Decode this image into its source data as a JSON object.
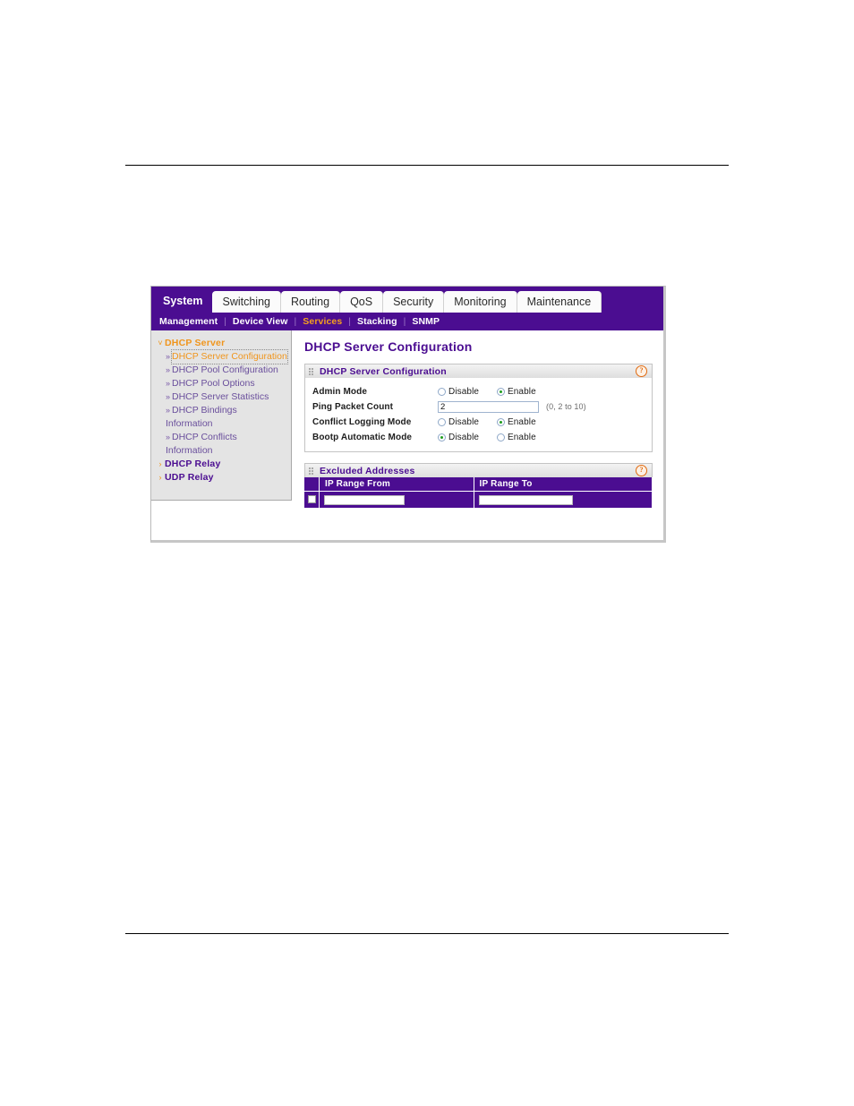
{
  "window": {
    "main_tabs": [
      {
        "label": "System",
        "active": true
      },
      {
        "label": "Switching",
        "active": false
      },
      {
        "label": "Routing",
        "active": false
      },
      {
        "label": "QoS",
        "active": false
      },
      {
        "label": "Security",
        "active": false
      },
      {
        "label": "Monitoring",
        "active": false
      },
      {
        "label": "Maintenance",
        "active": false
      }
    ],
    "sub_nav": [
      {
        "label": "Management",
        "active": false
      },
      {
        "label": "Device View",
        "active": false
      },
      {
        "label": "Services",
        "active": true
      },
      {
        "label": "Stacking",
        "active": false
      },
      {
        "label": "SNMP",
        "active": false
      }
    ],
    "sub_nav_separator": "|"
  },
  "sidebar": {
    "root": {
      "label": "DHCP Server",
      "chevron": "expanded-chevron-icon",
      "chevron_glyph": "˅"
    },
    "items": [
      {
        "label": "DHCP Server Configuration",
        "bullet": "»",
        "selected": true
      },
      {
        "label": "DHCP Pool Configuration",
        "bullet": "»",
        "selected": false
      },
      {
        "label": "DHCP Pool Options",
        "bullet": "»",
        "selected": false
      },
      {
        "label": "DHCP Server Statistics",
        "bullet": "»",
        "selected": false
      },
      {
        "label": "DHCP Bindings",
        "label2": "Information",
        "bullet": "»",
        "selected": false
      },
      {
        "label": "DHCP Conflicts",
        "label2": "Information",
        "bullet": "»",
        "selected": false
      }
    ],
    "groups": [
      {
        "label": "DHCP Relay",
        "chevron_glyph": "›"
      },
      {
        "label": "UDP Relay",
        "chevron_glyph": "›"
      }
    ]
  },
  "main": {
    "page_title": "DHCP Server Configuration",
    "panel_config": {
      "title": "DHCP Server Configuration",
      "help_glyph": "?",
      "rows": {
        "admin_mode": {
          "label": "Admin Mode",
          "disable_label": "Disable",
          "enable_label": "Enable",
          "selected": "Enable"
        },
        "ping_packet_count": {
          "label": "Ping Packet Count",
          "value": "2",
          "hint": "(0, 2 to 10)"
        },
        "conflict_logging_mode": {
          "label": "Conflict Logging Mode",
          "disable_label": "Disable",
          "enable_label": "Enable",
          "selected": "Enable"
        },
        "bootp_automatic_mode": {
          "label": "Bootp Automatic Mode",
          "disable_label": "Disable",
          "enable_label": "Enable",
          "selected": "Disable"
        }
      }
    },
    "panel_excluded": {
      "title": "Excluded Addresses",
      "help_glyph": "?",
      "columns": [
        "IP Range From",
        "IP Range To"
      ],
      "rows": [
        {
          "checked": false,
          "ip_from": "",
          "ip_to": ""
        }
      ]
    }
  },
  "colors": {
    "brand_purple": "#4b0d91",
    "accent_orange": "#f0951c",
    "radio_on_green": "#1f9e1f",
    "help_orange": "#e06a10",
    "sidebar_bg": "#e4e4e4"
  }
}
